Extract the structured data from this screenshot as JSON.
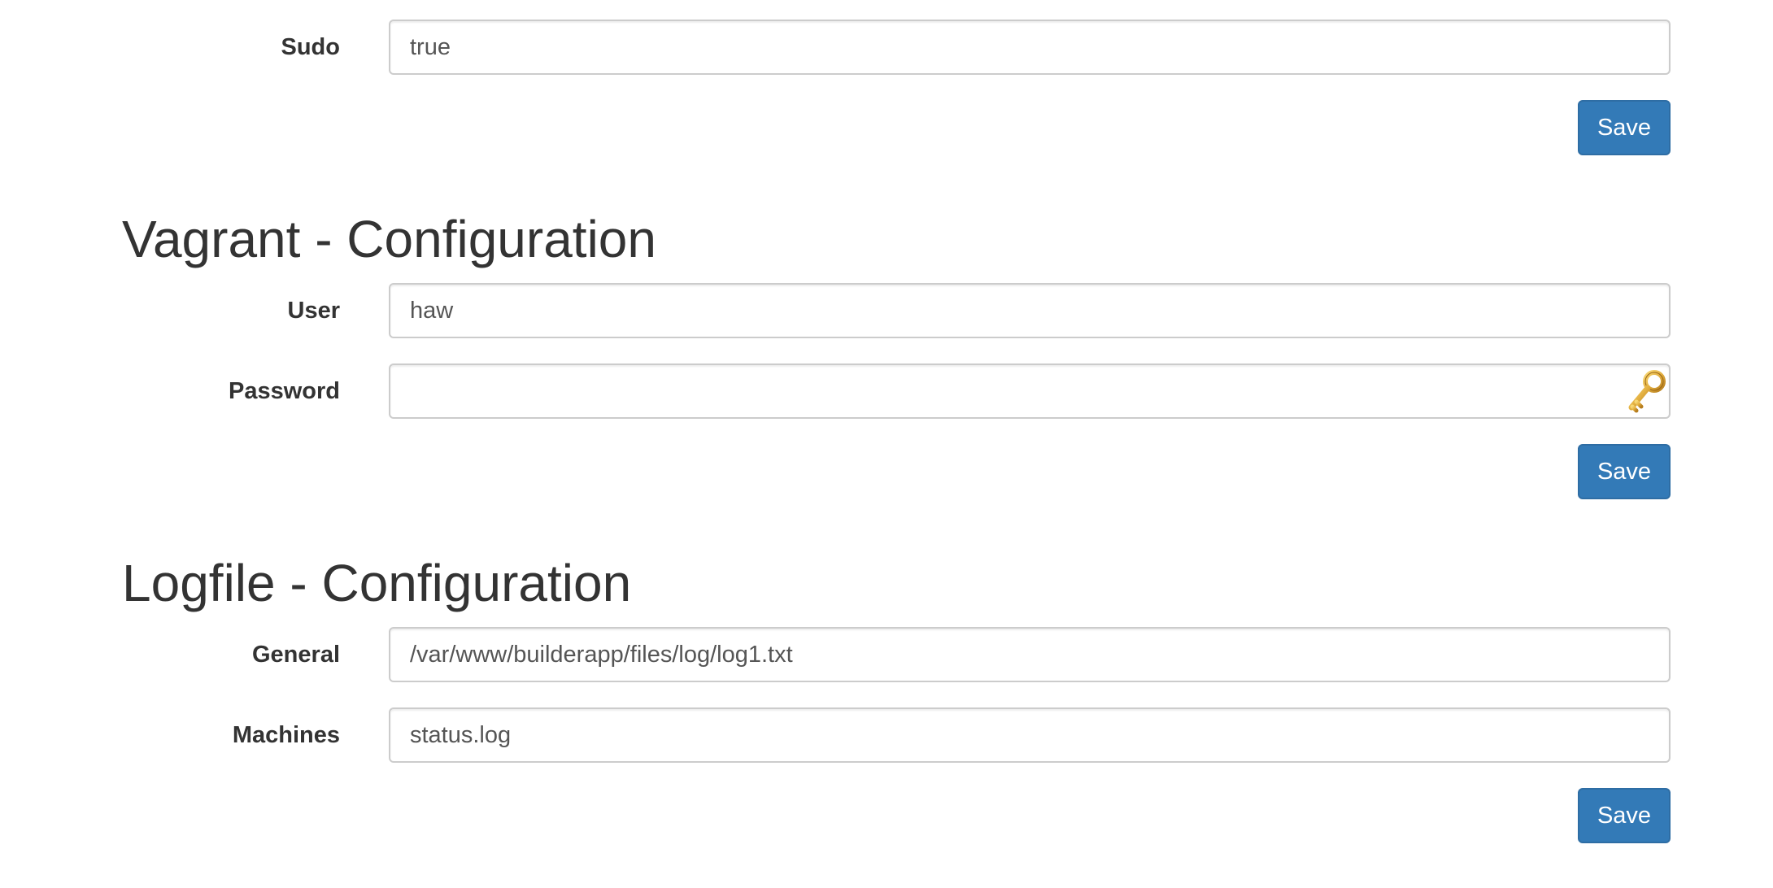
{
  "sudo_section": {
    "fields": [
      {
        "label": "Sudo",
        "value": "true"
      }
    ],
    "save_label": "Save"
  },
  "vagrant_section": {
    "title": "Vagrant - Configuration",
    "fields": [
      {
        "label": "User",
        "value": "haw"
      },
      {
        "label": "Password",
        "value": "",
        "icon": "key-icon"
      }
    ],
    "save_label": "Save"
  },
  "logfile_section": {
    "title": "Logfile - Configuration",
    "fields": [
      {
        "label": "General",
        "value": "/var/www/builderapp/files/log/log1.txt"
      },
      {
        "label": "Machines",
        "value": "status.log"
      }
    ],
    "save_label": "Save"
  },
  "colors": {
    "primary_button": "#337ab7",
    "text": "#333333",
    "input_border": "#cccccc"
  }
}
